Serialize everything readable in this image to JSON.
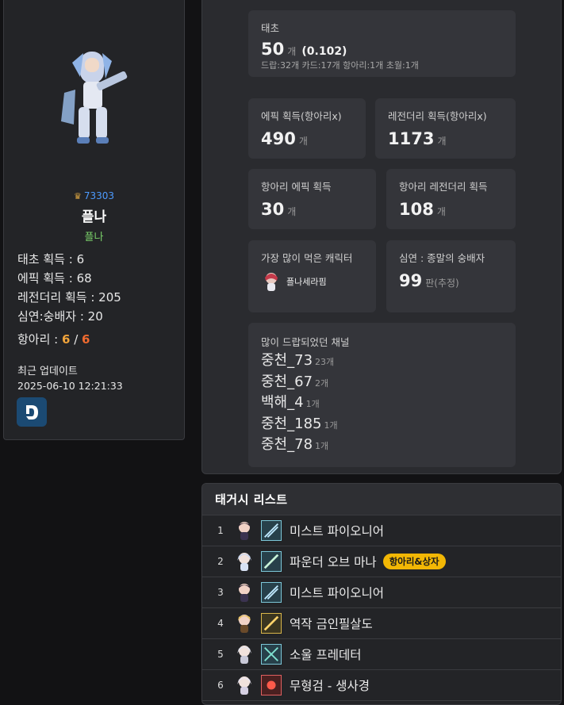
{
  "profile": {
    "rank": "73303",
    "name": "플나",
    "class": "플나",
    "stats": [
      {
        "label": "태초 획득 : ",
        "value": "6"
      },
      {
        "label": "에픽 획득 : ",
        "value": "68"
      },
      {
        "label": "레전더리 획득 : ",
        "value": "205"
      },
      {
        "label": "심연:숭배자 : ",
        "value": "20"
      }
    ],
    "hangari_label": "항아리 : ",
    "hangari_value1": "6",
    "hangari_sep": " / ",
    "hangari_value2": "6",
    "update_label": "최근 업데이트",
    "update_time": "2025-06-10 12:21:33",
    "dbutton_letter": "D"
  },
  "panel": {
    "taecho": {
      "label": "태초",
      "value": "50",
      "unit": "개",
      "paren": "(0.102)",
      "sub": "드랍:32개 카드:17개 항아리:1개 초월:1개"
    },
    "epic": {
      "label": "에픽 획득(항아리x)",
      "value": "490",
      "unit": "개"
    },
    "legendary": {
      "label": "레전더리 획득(항아리x)",
      "value": "1173",
      "unit": "개"
    },
    "hangari_epic": {
      "label": "항아리 에픽 획득",
      "value": "30",
      "unit": "개"
    },
    "hangari_legend": {
      "label": "항아리 레전더리 획득",
      "value": "108",
      "unit": "개"
    },
    "most_char": {
      "label": "가장 많이 먹은 캐릭터",
      "name": "플나세라핌"
    },
    "abyss": {
      "label": "심연 : 종말의 숭배자",
      "value": "99",
      "unit": "판(추정)"
    },
    "channels": {
      "label": "많이 드랍되었던 채널",
      "items": [
        {
          "name": "중천_73",
          "count": "23개"
        },
        {
          "name": "중천_67",
          "count": "2개"
        },
        {
          "name": "백해_4",
          "count": "1개"
        },
        {
          "name": "중천_185",
          "count": "1개"
        },
        {
          "name": "중천_78",
          "count": "1개"
        }
      ]
    }
  },
  "list": {
    "title": "태거시 리스트",
    "rows": [
      {
        "num": "1",
        "name": "미스트 파이오니어",
        "badge": ""
      },
      {
        "num": "2",
        "name": "파운더 오브 마나",
        "badge": "항아리&상자"
      },
      {
        "num": "3",
        "name": "미스트 파이오니어",
        "badge": ""
      },
      {
        "num": "4",
        "name": "역작 금인필살도",
        "badge": ""
      },
      {
        "num": "5",
        "name": "소울 프레데터",
        "badge": ""
      },
      {
        "num": "6",
        "name": "무형검 - 생사경",
        "badge": ""
      }
    ]
  },
  "colors": {
    "accent_blue": "#4d9bff",
    "class_green": "#7ad06a",
    "hangari_orange": "#f0a33b",
    "badge_yellow": "#f2b705"
  }
}
